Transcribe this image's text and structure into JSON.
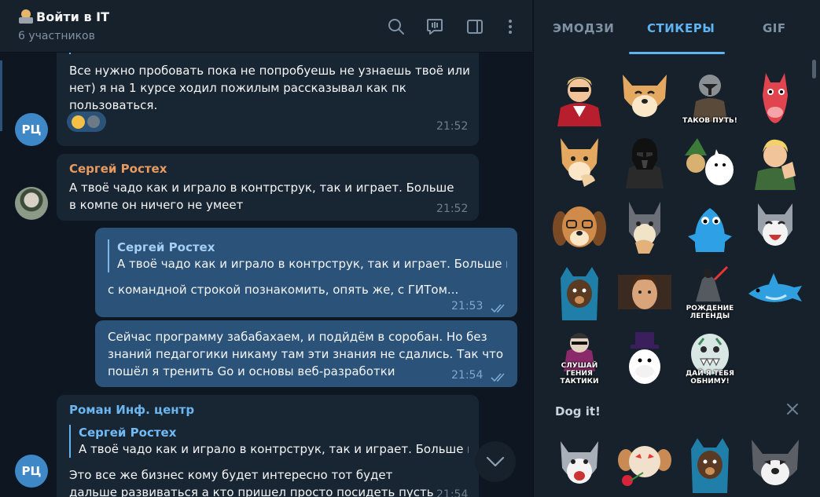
{
  "header": {
    "title": "Войти в IT",
    "subtitle": "6 участников"
  },
  "messages": [
    {
      "text": "Все нужно пробовать пока не попробуешь не узнаешь твоё или нет) я на 1 курсе ходил пожилым рассказывал как пк пользоваться.",
      "time": "21:52",
      "avatar_initials": "РЦ"
    },
    {
      "sender": "Сергей Ростех",
      "text": "А твоё чадо как и играло в контрструк, так и играет. Больше в компе он ничего не умеет",
      "time": "21:52"
    },
    {
      "reply_name": "Сергей Ростех",
      "reply_text": "А твоё чадо как и играло в контрструк, так и играет. Больше в...",
      "text": "с командной строкой познакомить, опять же, с ГИТом...",
      "time": "21:53"
    },
    {
      "text": "Сейчас программу забабахаем, и подйдём в сорoбан. Но без знаний педагогики никаму там эти знания не сдались. Так что пошёл я тренить Go и основы веб-разработки",
      "time": "21:54"
    },
    {
      "sender": "Роман Инф. центр",
      "reply_name": "Сергей Ростех",
      "reply_text": "А твоё чадо как и играло в контрструк, так и играет. Больше в...",
      "text": "Это все же бизнес кому будет интересно тот будет дальше развиваться а кто пришел просто посидеть пусть сидит",
      "time": "21:54",
      "avatar_initials": "РЦ"
    }
  ],
  "sticker_panel": {
    "tabs": [
      "ЭМОДЗИ",
      "СТИКЕРЫ",
      "GIF"
    ],
    "active_tab": "СТИКЕРЫ",
    "captions": {
      "s3": "ТАКОВ ПУТЬ!",
      "s15": "РОЖДЕНИЕ ЛЕГЕНДЫ",
      "s17": "СЛУШАЙ ГЕНИЯ ТАКТИКИ",
      "s19": "ДАЙ Я ТЕБЯ ОБНИМУ!"
    },
    "set_title": "Dog it!"
  },
  "colors": {
    "accent": "#5fb3f1",
    "outgoing_bubble": "#2b5278",
    "incoming_bubble": "#182533",
    "background": "#0e1621"
  }
}
